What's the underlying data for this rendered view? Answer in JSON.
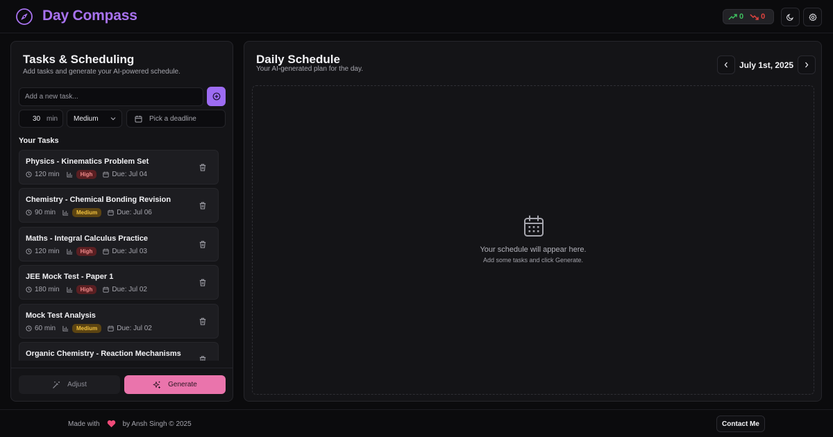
{
  "app": {
    "title": "Day Compass",
    "logo_icon": "compass-icon",
    "accent_color": "#a872ef"
  },
  "header": {
    "stats": {
      "up_count": "0",
      "down_count": "0",
      "up_icon": "trending-up-icon",
      "down_icon": "trending-down-icon"
    },
    "theme_icon": "moon-icon",
    "settings_icon": "gear-icon"
  },
  "tasks_panel": {
    "title": "Tasks & Scheduling",
    "subtitle": "Add tasks and generate your AI-powered schedule.",
    "task_input": {
      "placeholder": "Add a new task...",
      "value": ""
    },
    "duration": {
      "value": "30",
      "unit": "min"
    },
    "priority": {
      "selected": "Medium"
    },
    "deadline": {
      "placeholder": "Pick a deadline"
    },
    "list_heading": "Your Tasks",
    "tasks": [
      {
        "title": "Physics - Kinematics Problem Set",
        "duration": "120 min",
        "priority": "High",
        "due": "Due: Jul 04"
      },
      {
        "title": "Chemistry - Chemical Bonding Revision",
        "duration": "90 min",
        "priority": "Medium",
        "due": "Due: Jul 06"
      },
      {
        "title": "Maths - Integral Calculus Practice",
        "duration": "120 min",
        "priority": "High",
        "due": "Due: Jul 03"
      },
      {
        "title": "JEE Mock Test - Paper 1",
        "duration": "180 min",
        "priority": "High",
        "due": "Due: Jul 02"
      },
      {
        "title": "Mock Test Analysis",
        "duration": "60 min",
        "priority": "Medium",
        "due": "Due: Jul 02"
      },
      {
        "title": "Organic Chemistry - Reaction Mechanisms",
        "duration": "",
        "priority": "",
        "due": ""
      }
    ],
    "adjust_label": "Adjust",
    "generate_label": "Generate",
    "generate_color": "#ea74ac"
  },
  "schedule_panel": {
    "title": "Daily Schedule",
    "subtitle": "Your AI-generated plan for the day.",
    "date": "July 1st, 2025",
    "empty_title": "Your schedule will appear here.",
    "empty_subtitle": "Add some tasks and click Generate.",
    "empty_icon": "calendar-icon"
  },
  "footer": {
    "made_with": "Made with",
    "by_text": "by Ansh Singh © 2025",
    "heart_icon": "heart-icon",
    "contact_label": "Contact Me"
  },
  "priority_colors": {
    "High": "#f08a8a",
    "Medium": "#f2c23f"
  }
}
